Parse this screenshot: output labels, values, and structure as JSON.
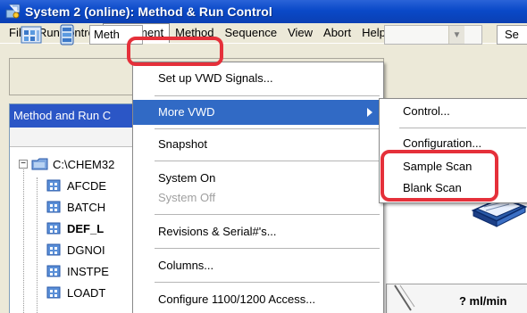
{
  "window": {
    "title": "System 2 (online): Method & Run Control"
  },
  "menubar": {
    "items": [
      "File",
      "RunControl",
      "Instrument",
      "Method",
      "Sequence",
      "View",
      "Abort",
      "Help"
    ]
  },
  "toolbar": {
    "method_field_text": "Meth",
    "right_field_text": "Se"
  },
  "left_panel": {
    "header": "Method and Run C",
    "tree": [
      {
        "label": "C:\\CHEM32",
        "bold": false
      },
      {
        "label": "AFCDE",
        "bold": false
      },
      {
        "label": "BATCH",
        "bold": false
      },
      {
        "label": "DEF_L",
        "bold": true
      },
      {
        "label": "DGNOI",
        "bold": false
      },
      {
        "label": "INSTPE",
        "bold": false
      },
      {
        "label": "LOADT",
        "bold": false
      }
    ]
  },
  "instrument_menu": {
    "items": [
      {
        "label": "Set up VWD  Signals...",
        "state": "normal"
      },
      {
        "label": "More VWD",
        "state": "selected",
        "submenu": true
      },
      {
        "label": "Snapshot",
        "state": "normal"
      },
      {
        "label": "System On",
        "state": "normal"
      },
      {
        "label": "System Off",
        "state": "disabled"
      },
      {
        "label": "Revisions & Serial#'s...",
        "state": "normal"
      },
      {
        "label": "Columns...",
        "state": "normal"
      },
      {
        "label": "Configure 1100/1200 Access...",
        "state": "normal"
      }
    ]
  },
  "more_vwd_submenu": {
    "items": [
      {
        "label": "Control..."
      },
      {
        "label": "Configuration..."
      },
      {
        "label": "Sample Scan"
      },
      {
        "label": "Blank Scan"
      }
    ]
  },
  "right_pane": {
    "flow_text": "? ml/min"
  },
  "colors": {
    "title_bar": "#0a49c8",
    "menu_highlight": "#316ac5",
    "annotation_red": "#e5303a",
    "panel_header": "#2b56c6"
  }
}
